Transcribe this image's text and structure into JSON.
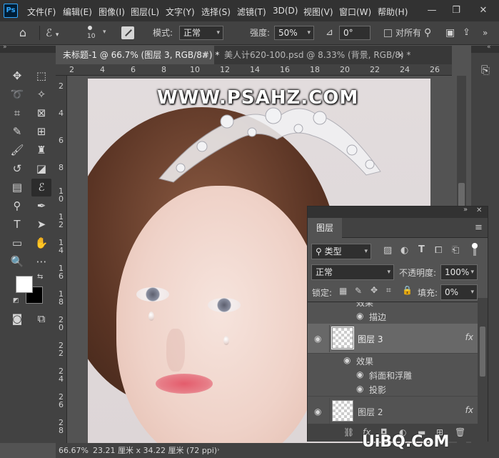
{
  "app": {
    "logo": "Ps"
  },
  "menu": [
    "文件(F)",
    "编辑(E)",
    "图像(I)",
    "图层(L)",
    "文字(Y)",
    "选择(S)",
    "滤镜(T)",
    "3D(D)",
    "视图(V)",
    "窗口(W)",
    "帮助(H)"
  ],
  "window_controls": {
    "minimize": "—",
    "maximize": "❐",
    "close": "✕"
  },
  "options": {
    "brush_size": "10",
    "mode_label": "模式:",
    "mode_value": "正常",
    "strength_label": "强度:",
    "strength_value": "50%",
    "angle_value": "0°",
    "all_layers_label": "对所有"
  },
  "tabs": [
    {
      "label": "未标题-1 @ 66.7% (图层 3, RGB/8#) *",
      "close": "×"
    },
    {
      "label": "美人计620-100.psd @ 8.33% (背景, RGB/8) *",
      "close": "×"
    }
  ],
  "ruler": {
    "h": [
      "2",
      "4",
      "6",
      "8",
      "10",
      "12",
      "14",
      "16",
      "18",
      "20",
      "22",
      "24",
      "26"
    ],
    "v": [
      "2",
      "4",
      "6",
      "8",
      "1\n0",
      "1\n2",
      "1\n4",
      "1\n6",
      "1\n8",
      "2\n0",
      "2\n2",
      "2\n4",
      "2\n6",
      "2\n8"
    ]
  },
  "watermark": "WWW.PSAHZ.COM",
  "status": {
    "zoom": "66.67%",
    "doc_info": "23.21 厘米 x 34.22 厘米 (72 ppi)"
  },
  "layers_panel": {
    "tab_label": "图层",
    "kind_label": "类型",
    "blend_mode": "正常",
    "opacity_label": "不透明度:",
    "opacity_value": "100%",
    "lock_label": "锁定:",
    "fill_label": "填充:",
    "fill_value": "0%",
    "rows": [
      {
        "type": "sub",
        "label": "效果"
      },
      {
        "type": "sub",
        "label": "描边"
      },
      {
        "type": "layer",
        "label": "图层 3",
        "fx": "fx"
      },
      {
        "type": "sub",
        "label": "效果"
      },
      {
        "type": "sub",
        "label": "斜面和浮雕"
      },
      {
        "type": "sub",
        "label": "投影"
      },
      {
        "type": "layer",
        "label": "图层 2",
        "fx": "fx"
      }
    ]
  },
  "corner_watermark": "UiBQ.CoM"
}
